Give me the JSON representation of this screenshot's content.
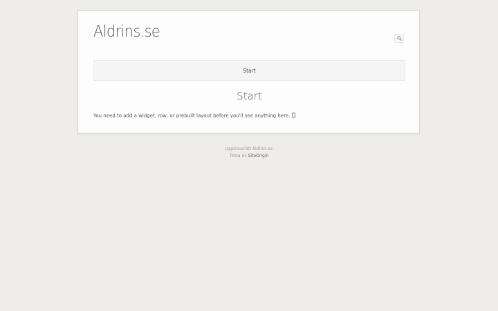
{
  "header": {
    "site_title": "Aldrins.se"
  },
  "nav": {
    "items": [
      {
        "label": "Start"
      }
    ]
  },
  "main": {
    "entry_title": "Start",
    "content_text": "You need to add a widget, row, or prebuilt layout before you'll see anything here."
  },
  "footer": {
    "copyright": "Upphovsrätt Aldrins.se",
    "theme_prefix": "Tema av",
    "theme_link": "SiteOrigin"
  },
  "colors": {
    "background": "#efede9",
    "page": "#fdfdfd",
    "text": "#555555"
  }
}
